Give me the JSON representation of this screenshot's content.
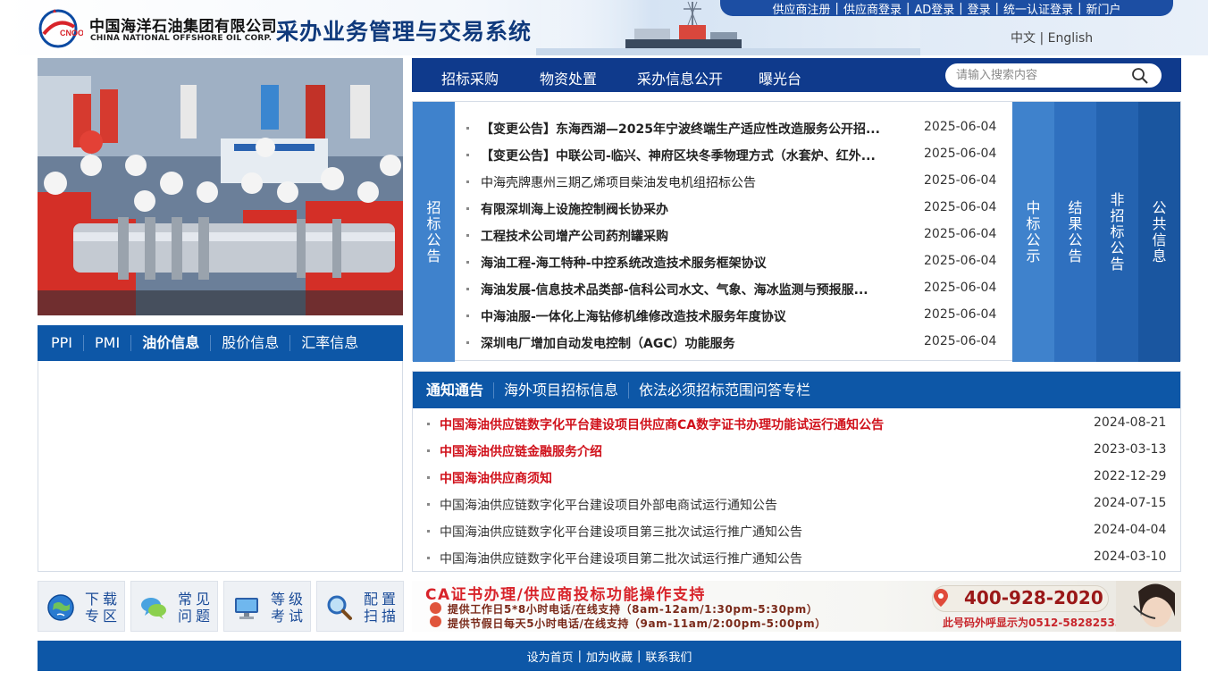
{
  "header": {
    "company_cn": "中国海洋石油集团有限公司",
    "company_en": "CHINA NATIONAL OFFSHORE OIL CORP.",
    "system_title": "采办业务管理与交易系统",
    "top_links": [
      "供应商注册",
      "供应商登录",
      "AD登录",
      "登录",
      "统一认证登录",
      "新门户"
    ],
    "lang_cn": "中文",
    "lang_en": "English"
  },
  "nav": {
    "items": [
      "招标采购",
      "物资处置",
      "采办信息公开",
      "曝光台"
    ],
    "search_placeholder": "请输入搜索内容"
  },
  "price_tabs": {
    "items": [
      "PPI",
      "PMI",
      "油价信息",
      "股价信息",
      "汇率信息"
    ],
    "active": "油价信息"
  },
  "tender": {
    "active_tab": [
      "招",
      "标",
      "公",
      "告"
    ],
    "side_tabs": [
      [
        "中",
        "标",
        "公",
        "示"
      ],
      [
        "结",
        "果",
        "公",
        "告"
      ],
      [
        "非",
        "招",
        "标",
        "公",
        "告"
      ],
      [
        "公",
        "共",
        "信",
        "息"
      ]
    ],
    "rows": [
      {
        "title": "【变更公告】东海西湖—2025年宁波终端生产适应性改造服务公开招...",
        "date": "2025-06-04",
        "bold": true
      },
      {
        "title": "【变更公告】中联公司-临兴、神府区块冬季物理方式（水套炉、红外...",
        "date": "2025-06-04",
        "bold": true
      },
      {
        "title": "中海壳牌惠州三期乙烯项目柴油发电机组招标公告",
        "date": "2025-06-04",
        "bold": false
      },
      {
        "title": "有限深圳海上设施控制阀长协采办",
        "date": "2025-06-04",
        "bold": true
      },
      {
        "title": "工程技术公司增产公司药剂罐采购",
        "date": "2025-06-04",
        "bold": true
      },
      {
        "title": "海油工程-海工特种-中控系统改造技术服务框架协议",
        "date": "2025-06-04",
        "bold": true
      },
      {
        "title": "海油发展-信息技术品类部-信科公司水文、气象、海冰监测与预报服...",
        "date": "2025-06-04",
        "bold": true
      },
      {
        "title": "中海油服-一体化上海钻修机维修改造技术服务年度协议",
        "date": "2025-06-04",
        "bold": true
      },
      {
        "title": "深圳电厂增加自动发电控制（AGC）功能服务",
        "date": "2025-06-04",
        "bold": true
      }
    ]
  },
  "notice": {
    "tabs": [
      "通知通告",
      "海外项目招标信息",
      "依法必须招标范围问答专栏"
    ],
    "rows": [
      {
        "title": "中国海油供应链数字化平台建设项目供应商CA数字证书办理功能试运行通知公告",
        "date": "2024-08-21",
        "red": true
      },
      {
        "title": "中国海油供应链金融服务介绍",
        "date": "2023-03-13",
        "red": true
      },
      {
        "title": "中国海油供应商须知",
        "date": "2022-12-29",
        "red": true
      },
      {
        "title": "中国海油供应链数字化平台建设项目外部电商试运行通知公告",
        "date": "2024-07-15",
        "red": false
      },
      {
        "title": "中国海油供应链数字化平台建设项目第三批次试运行推广通知公告",
        "date": "2024-04-04",
        "red": false
      },
      {
        "title": "中国海油供应链数字化平台建设项目第二批次试运行推广通知公告",
        "date": "2024-03-10",
        "red": false
      }
    ]
  },
  "quick_links": [
    {
      "label": "下载专区",
      "icon": "globe-icon"
    },
    {
      "label": "常见问题",
      "icon": "chat-bubbles-icon"
    },
    {
      "label": "等级考试",
      "icon": "monitor-icon"
    },
    {
      "label": "配置扫描",
      "icon": "magnifier-icon"
    }
  ],
  "ca_banner": {
    "title": "CA证书办理/供应商投标功能操作支持",
    "line1": "提供工作日5*8小时电话/在线支持（8am-12am/1:30pm-5:30pm）",
    "line2": "提供节假日每天5小时电话/在线支持（9am-11am/2:00pm-5:00pm）",
    "phone": "400-928-2020",
    "note": "此号码外呼显示为0512-58282533"
  },
  "footer": {
    "links": [
      "设为首页",
      "加为收藏",
      "联系我们"
    ]
  },
  "colors": {
    "nav_dark": "#0f3a8c",
    "tab_blue": "#0d57a7",
    "vtab_light": "#3f82cc",
    "highlight_red": "#d0101a"
  }
}
